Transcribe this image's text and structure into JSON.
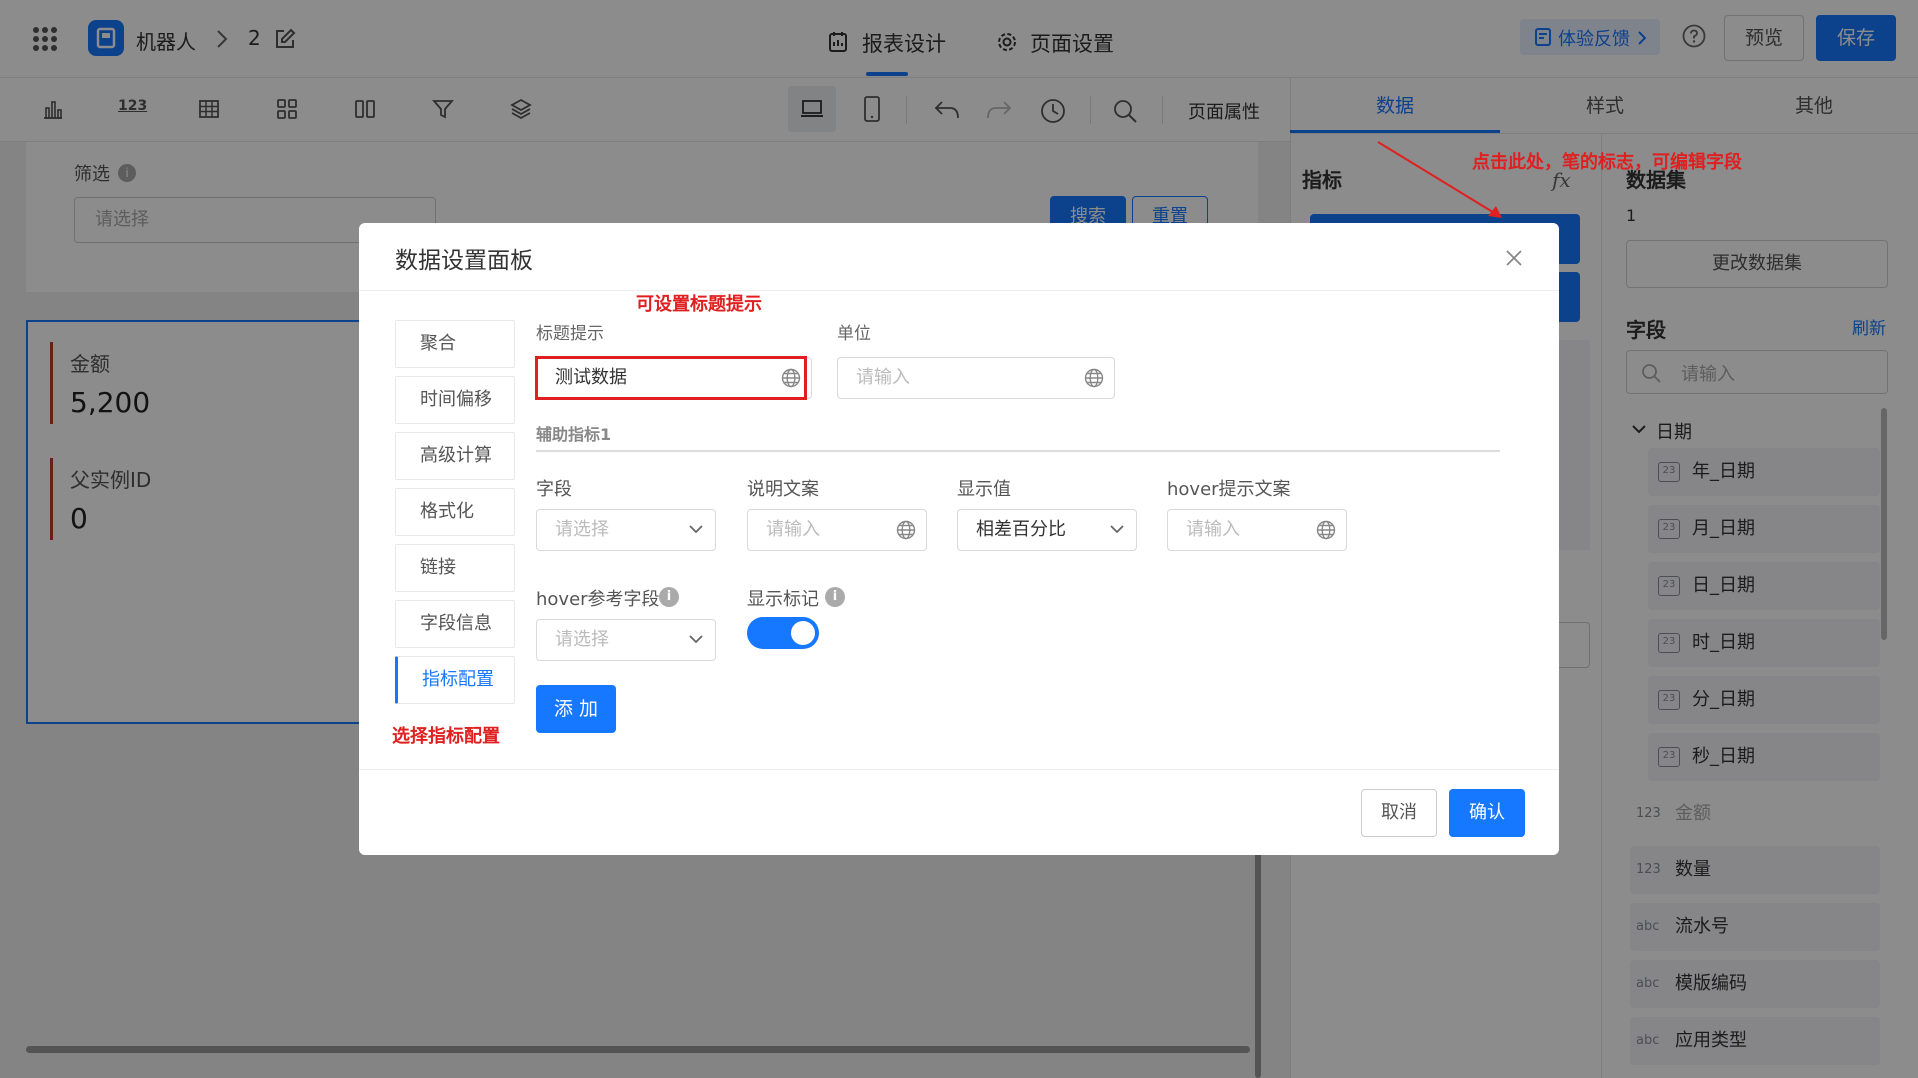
{
  "header": {
    "app_name": "机器人",
    "page_number": "2",
    "tab_report_design": "报表设计",
    "tab_page_settings": "页面设置",
    "feedback_label": "体验反馈",
    "preview_label": "预览",
    "save_label": "保存"
  },
  "toolbar": {
    "number_icon_text": "123",
    "page_properties": "页面属性"
  },
  "canvas": {
    "filter_label": "筛选",
    "filter_placeholder": "请选择",
    "search_button": "搜索",
    "reset_button": "重置",
    "kpi": [
      {
        "label": "金额",
        "value": "5,200"
      },
      {
        "label": "父实例ID",
        "value": "0"
      }
    ]
  },
  "right_panel": {
    "tabs": [
      "数据",
      "样式",
      "其他"
    ],
    "metrics_title": "指标",
    "fx_label": "fx",
    "dataset_title": "数据集",
    "dataset_value": "1",
    "change_dataset_button": "更改数据集",
    "fields_title": "字段",
    "refresh_link": "刷新",
    "field_search_placeholder": "请输入",
    "date_group": "日期",
    "date_fields": [
      "年_日期",
      "月_日期",
      "日_日期",
      "时_日期",
      "分_日期",
      "秒_日期"
    ],
    "date_badge": "23",
    "other_fields": [
      {
        "kind": "123",
        "name": "金额"
      },
      {
        "kind": "123",
        "name": "数量"
      },
      {
        "kind": "abc",
        "name": "流水号"
      },
      {
        "kind": "abc",
        "name": "模版编码"
      },
      {
        "kind": "abc",
        "name": "应用类型"
      }
    ]
  },
  "modal": {
    "title": "数据设置面板",
    "side_items": [
      "聚合",
      "时间偏移",
      "高级计算",
      "格式化",
      "链接",
      "字段信息",
      "指标配置"
    ],
    "title_hint_label": "标题提示",
    "title_hint_value": "测试数据",
    "unit_label": "单位",
    "unit_placeholder": "请输入",
    "aux_section_title": "辅助指标1",
    "field_label": "字段",
    "field_placeholder": "请选择",
    "desc_label": "说明文案",
    "desc_placeholder": "请输入",
    "display_value_label": "显示值",
    "display_value_selected": "相差百分比",
    "hover_text_label": "hover提示文案",
    "hover_text_placeholder": "请输入",
    "hover_ref_label": "hover参考字段",
    "hover_ref_placeholder": "请选择",
    "show_marker_label": "显示标记",
    "show_marker_on": true,
    "add_button": "添 加",
    "cancel_button": "取消",
    "confirm_button": "确认"
  },
  "annotations": {
    "top_right": "点击此处，笔的标志，可编辑字段",
    "title_hint": "可设置标题提示",
    "indicator_config": "选择指标配置"
  },
  "colors": {
    "primary": "#1677ff",
    "annotation": "#e02020"
  }
}
